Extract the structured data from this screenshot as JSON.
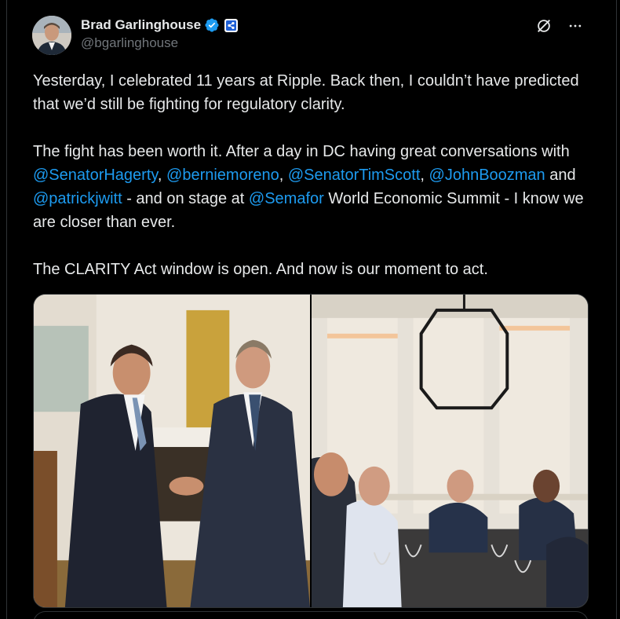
{
  "author": {
    "display_name": "Brad Garlinghouse",
    "handle": "@bgarlinghouse"
  },
  "tweet": {
    "p1": "Yesterday, I celebrated 11 years at Ripple. Back then, I couldn’t have predicted that we’d still be fighting for regulatory clarity.",
    "p2_intro": "The fight has been worth it. After a day in DC having great conversations with ",
    "m1": "@SenatorHagerty",
    "sep1": ", ",
    "m2": "@berniemoreno",
    "sep2": ", ",
    "m3": "@SenatorTimScott",
    "sep3": ", ",
    "m4": "@JohnBoozman",
    "and": " and ",
    "m5": "@patrickjwitt",
    "mid": " - and on stage at ",
    "m6": "@Semafor",
    "p2_end": " World Economic Summit - I know we are closer than ever.",
    "p3": "The CLARITY Act window is open. And now is our moment to act."
  },
  "colors": {
    "background": "#000000",
    "text": "#e7e9ea",
    "secondary": "#71767b",
    "accent": "#1d9bf0",
    "verified": "#1d9bf0"
  },
  "icons": {
    "verified": "verified-badge-icon",
    "affiliate": "ripple-logo-icon",
    "grok": "grok-icon",
    "more": "more-dots-icon"
  }
}
